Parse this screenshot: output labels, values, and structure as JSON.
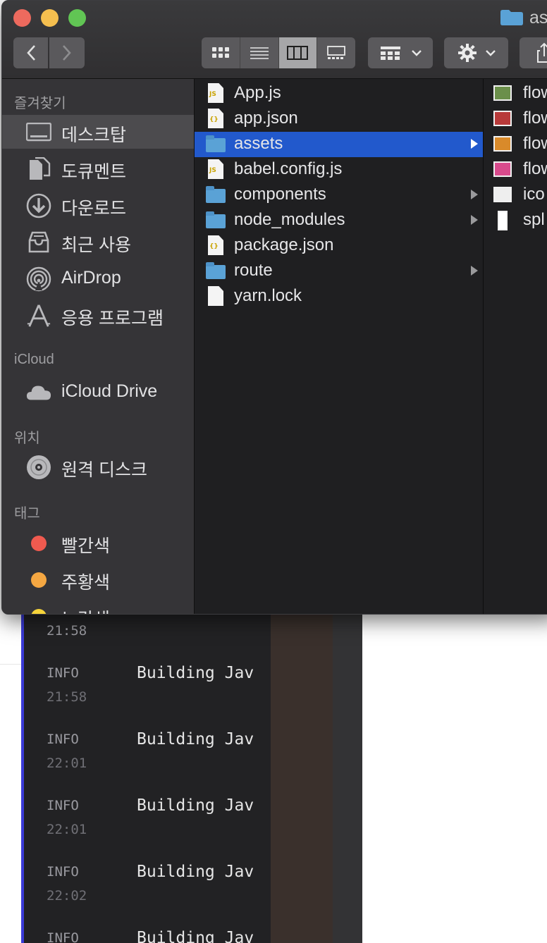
{
  "finder": {
    "window_title": "as",
    "sidebar": {
      "favorites_header": "즐겨찾기",
      "favorites": [
        {
          "label": "데스크탑",
          "icon": "desktop-icon"
        },
        {
          "label": "도큐멘트",
          "icon": "documents-icon"
        },
        {
          "label": "다운로드",
          "icon": "downloads-icon"
        },
        {
          "label": "최근 사용",
          "icon": "recents-icon"
        },
        {
          "label": "AirDrop",
          "icon": "airdrop-icon"
        },
        {
          "label": "응용 프로그램",
          "icon": "applications-icon"
        }
      ],
      "icloud_header": "iCloud",
      "icloud": [
        {
          "label": "iCloud Drive",
          "icon": "cloud-icon"
        }
      ],
      "locations_header": "위치",
      "locations": [
        {
          "label": "원격 디스크",
          "icon": "disc-icon"
        }
      ],
      "tags_header": "태그",
      "tags": [
        {
          "label": "빨간색",
          "color": "#f05a4f"
        },
        {
          "label": "주황색",
          "color": "#f5a742"
        },
        {
          "label": "노란색",
          "color": "#f5d33a"
        }
      ]
    },
    "column1": [
      {
        "name": "App.js",
        "kind": "js"
      },
      {
        "name": "app.json",
        "kind": "json"
      },
      {
        "name": "assets",
        "kind": "folder",
        "selected": true
      },
      {
        "name": "babel.config.js",
        "kind": "js"
      },
      {
        "name": "components",
        "kind": "folder"
      },
      {
        "name": "node_modules",
        "kind": "folder"
      },
      {
        "name": "package.json",
        "kind": "json"
      },
      {
        "name": "route",
        "kind": "folder"
      },
      {
        "name": "yarn.lock",
        "kind": "file"
      }
    ],
    "column2": [
      {
        "name": "flow",
        "thumb": "#6b8f4a"
      },
      {
        "name": "flow",
        "thumb": "#b83a3a"
      },
      {
        "name": "flow",
        "thumb": "#d98a2a"
      },
      {
        "name": "flow",
        "thumb": "#d84a8c"
      },
      {
        "name": "ico",
        "thumb": "#eeeeee"
      },
      {
        "name": "spl",
        "thumb": "#ffffff"
      }
    ],
    "accent": "#2259cc"
  },
  "terminal": {
    "top_time": "21:58",
    "entries": [
      {
        "level": "INFO",
        "message": "Building Jav",
        "time": "21:58"
      },
      {
        "level": "INFO",
        "message": "Building Jav",
        "time": "22:01"
      },
      {
        "level": "INFO",
        "message": "Building Jav",
        "time": "22:01"
      },
      {
        "level": "INFO",
        "message": "Building Jav",
        "time": "22:02"
      },
      {
        "level": "INFO",
        "message": "Building Jav",
        "time": ""
      }
    ]
  }
}
